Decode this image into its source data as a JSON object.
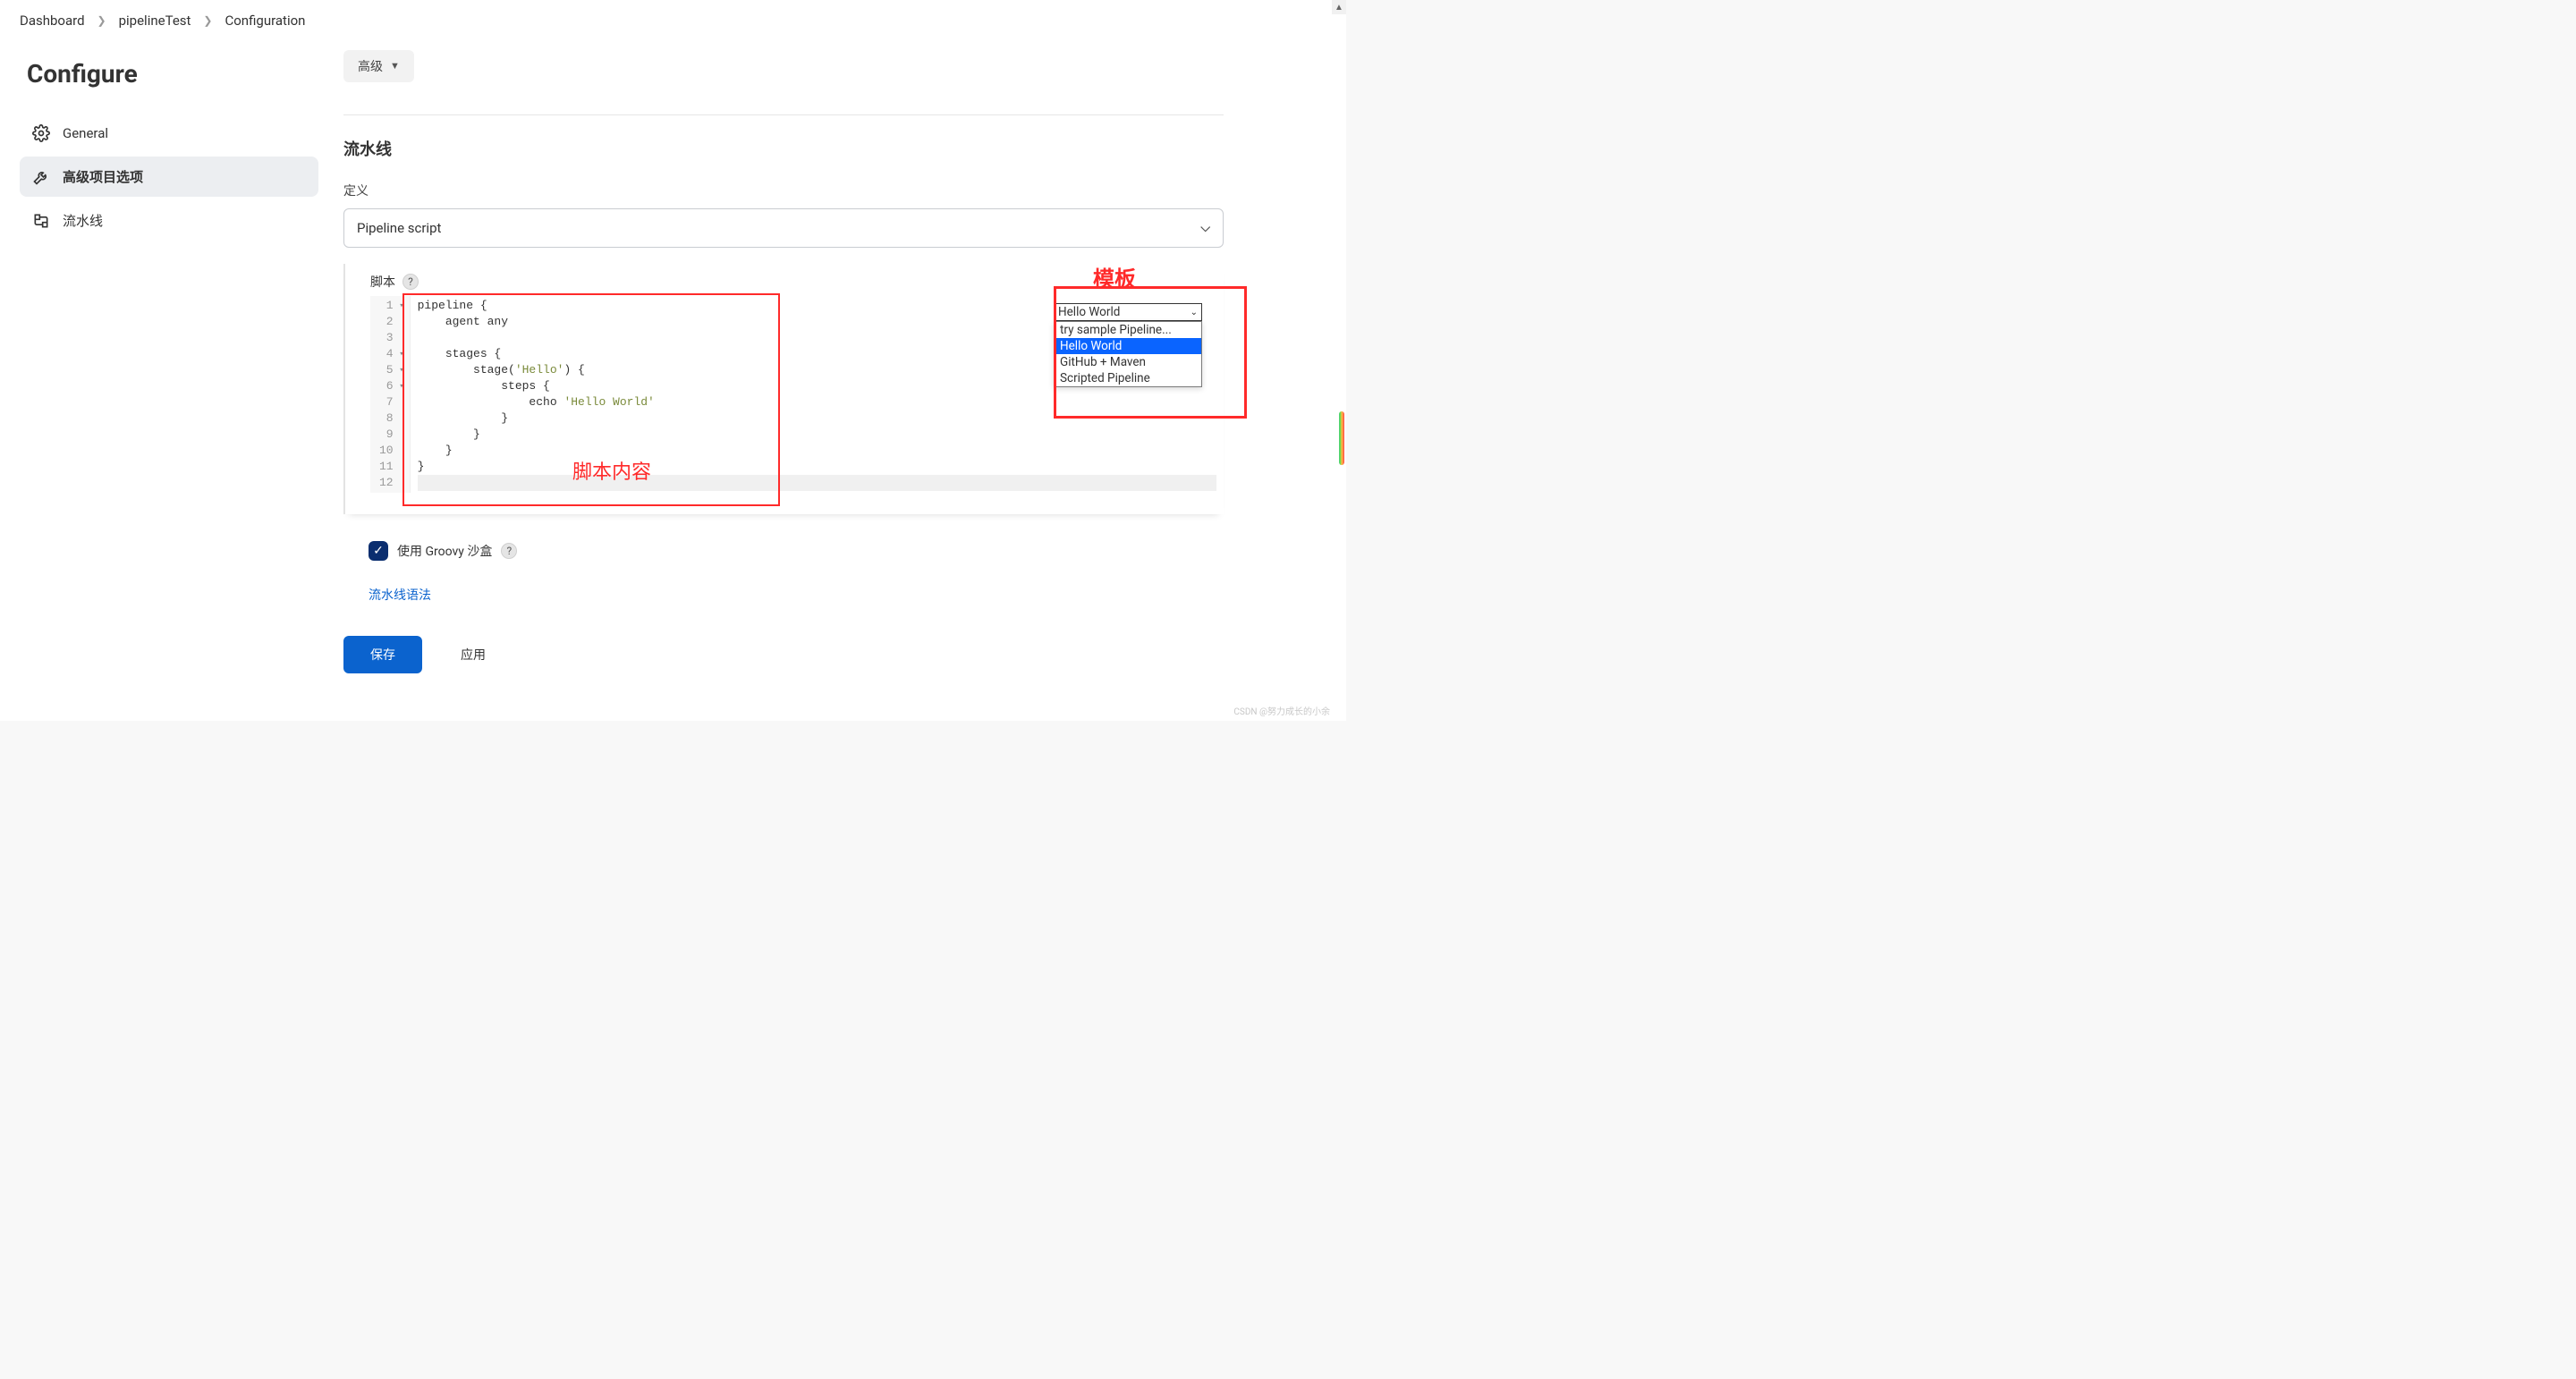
{
  "breadcrumb": {
    "items": [
      "Dashboard",
      "pipelineTest",
      "Configuration"
    ]
  },
  "page_title": "Configure",
  "sidebar": {
    "items": [
      {
        "label": "General",
        "icon": "gear-icon",
        "active": false
      },
      {
        "label": "高级项目选项",
        "icon": "wrench-icon",
        "active": true
      },
      {
        "label": "流水线",
        "icon": "pipeline-icon",
        "active": false
      }
    ]
  },
  "main": {
    "advanced_btn": "高级",
    "section_title": "流水线",
    "definition_label": "定义",
    "definition_value": "Pipeline script",
    "script_label": "脚本",
    "script_lines": [
      "pipeline {",
      "    agent any",
      "",
      "    stages {",
      "        stage('Hello') {",
      "            steps {",
      "                echo 'Hello World'",
      "            }",
      "        }",
      "    }",
      "}",
      ""
    ],
    "line_folds": [
      true,
      false,
      false,
      true,
      true,
      true,
      false,
      false,
      false,
      false,
      false,
      false
    ],
    "template": {
      "selected": "Hello World",
      "options": [
        "try sample Pipeline...",
        "Hello World",
        "GitHub + Maven",
        "Scripted Pipeline"
      ],
      "highlighted_index": 1
    },
    "sandbox_label": "使用 Groovy 沙盒",
    "syntax_link": "流水线语法",
    "save_btn": "保存",
    "apply_btn": "应用"
  },
  "annotations": {
    "script_content": "脚本内容",
    "template": "模板"
  },
  "watermark": "CSDN @努力成长的小余"
}
